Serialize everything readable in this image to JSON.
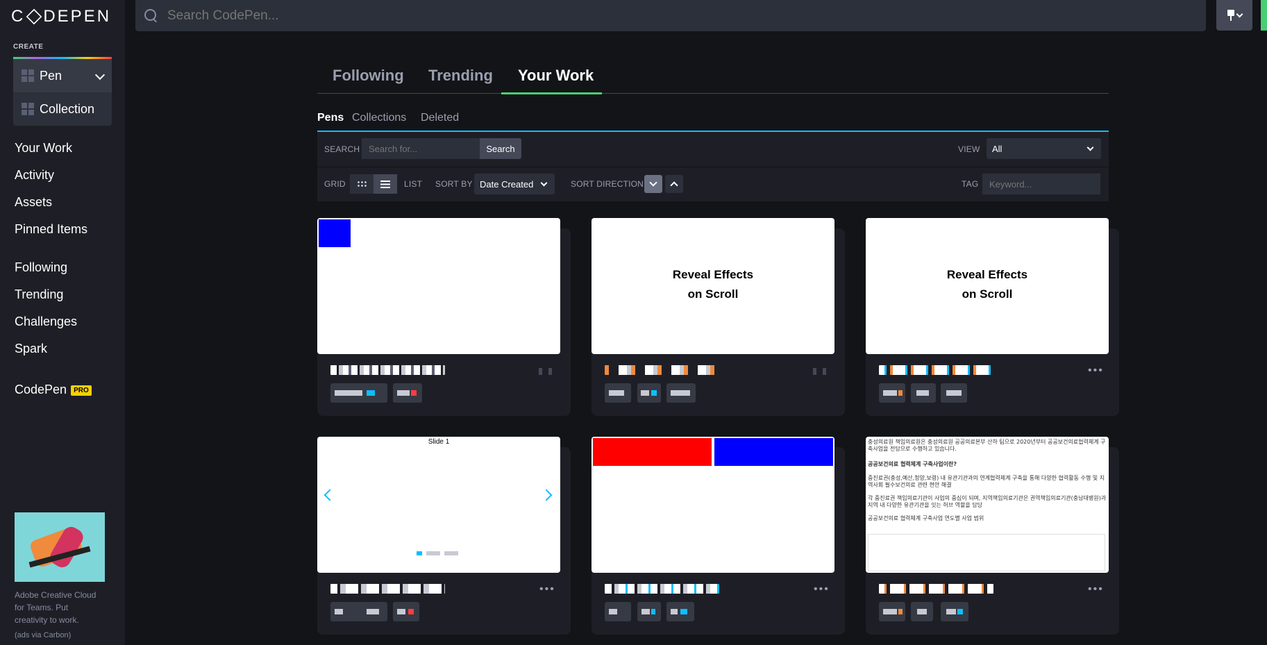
{
  "logo": "CODEPEN",
  "sidebar": {
    "create_label": "CREATE",
    "create_pen": "Pen",
    "create_collection": "Collection",
    "nav1": [
      "Your Work",
      "Activity",
      "Assets",
      "Pinned Items"
    ],
    "nav2": [
      "Following",
      "Trending",
      "Challenges",
      "Spark"
    ],
    "codepen": "CodePen",
    "pro_badge": "PRO",
    "ad_text": "Adobe Creative Cloud for Teams. Put creativity to work.",
    "ad_via": "(ads via Carbon)"
  },
  "topbar": {
    "search_placeholder": "Search CodePen..."
  },
  "main_tabs": [
    "Following",
    "Trending",
    "Your Work"
  ],
  "sub_tabs": [
    "Pens",
    "Collections",
    "Deleted"
  ],
  "filters": {
    "search_label": "SEARCH",
    "search_placeholder": "Search for...",
    "search_button": "Search",
    "view_label": "VIEW",
    "view_value": "All",
    "grid_label": "GRID",
    "list_label": "LIST",
    "sort_by_label": "SORT BY",
    "sort_by_value": "Date Created",
    "sort_direction_label": "SORT DIRECTION",
    "tag_label": "TAG",
    "tag_placeholder": "Keyword..."
  },
  "cards": {
    "c2_line1": "Reveal Effects",
    "c2_line2": "on Scroll",
    "c3_line1": "Reveal Effects",
    "c3_line2": "on Scroll",
    "c4_slide": "Slide 1",
    "c6_lines": [
      "충성의료원 책임의료원은 충성의료원 공공의료본부 산하 팀으로 2020년부터 공공보건의료협력체계 구축사업을 전담으로 수행하고 있습니다.",
      "공공보건의료 협력체계 구축사업이란?",
      "중진료권(충성,예산,청양,보령) 내 유관기관과의 연계협력체계 구축을 통해 다양한 협력활동 수행 및 지역사회 필수보건의료 관련 현안 해결",
      "각 중진료권 책임의료기관이 사업의 중심이 되며, 지역책임의료기관은 권역책임의료기관(충남대병원)과 지역 내 다양한 유관기관을 잇는 허브 역할을 담당",
      "공공보건의료 협력체계 구축사업 연도별 사업 범위"
    ]
  },
  "colors": {
    "accent_green": "#47cf73",
    "accent_blue": "#0ebeff",
    "pro_yellow": "#fcd000"
  }
}
